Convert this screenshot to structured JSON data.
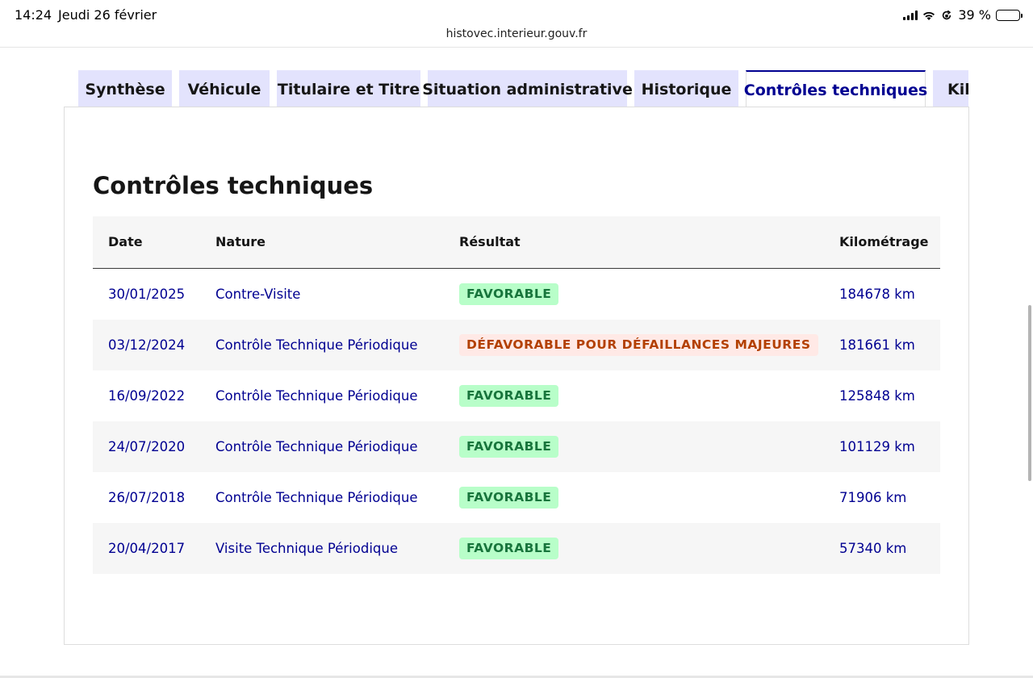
{
  "status_bar": {
    "time": "14:24",
    "date": "Jeudi 26 février",
    "battery_text": "39 %",
    "battery_level": 0.39,
    "url": "histovec.interieur.gouv.fr",
    "icons": [
      "signal-icon",
      "wifi-icon",
      "orientation-lock-icon",
      "battery-icon"
    ]
  },
  "tabs": [
    {
      "label": "Synthèse",
      "active": false
    },
    {
      "label": "Véhicule",
      "active": false
    },
    {
      "label": "Titulaire et Titre",
      "active": false
    },
    {
      "label": "Situation administrative",
      "active": false
    },
    {
      "label": "Historique",
      "active": false
    },
    {
      "label": "Contrôles techniques",
      "active": true
    },
    {
      "label": "Kilométrage",
      "active": false
    }
  ],
  "section": {
    "title": "Contrôles techniques"
  },
  "table": {
    "headers": {
      "date": "Date",
      "nature": "Nature",
      "result": "Résultat",
      "km": "Kilométrage"
    },
    "rows": [
      {
        "date": "30/01/2025",
        "nature": "Contre-Visite",
        "result": "FAVORABLE",
        "result_status": "favorable",
        "km": "184678 km"
      },
      {
        "date": "03/12/2024",
        "nature": "Contrôle Technique Périodique",
        "result": "DÉFAVORABLE POUR DÉFAILLANCES MAJEURES",
        "result_status": "defavorable",
        "km": "181661 km"
      },
      {
        "date": "16/09/2022",
        "nature": "Contrôle Technique Périodique",
        "result": "FAVORABLE",
        "result_status": "favorable",
        "km": "125848 km"
      },
      {
        "date": "24/07/2020",
        "nature": "Contrôle Technique Périodique",
        "result": "FAVORABLE",
        "result_status": "favorable",
        "km": "101129 km"
      },
      {
        "date": "26/07/2018",
        "nature": "Contrôle Technique Périodique",
        "result": "FAVORABLE",
        "result_status": "favorable",
        "km": "71906 km"
      },
      {
        "date": "20/04/2017",
        "nature": "Visite Technique Périodique",
        "result": "FAVORABLE",
        "result_status": "favorable",
        "km": "57340 km"
      }
    ]
  },
  "colors": {
    "accent": "#000091",
    "tab_inactive_bg": "#e3e3fd",
    "favorable_bg": "#b8fec9",
    "favorable_text": "#18753c",
    "defavorable_bg": "#ffe9e6",
    "defavorable_text": "#b34000",
    "row_alt_bg": "#f6f6f6"
  }
}
